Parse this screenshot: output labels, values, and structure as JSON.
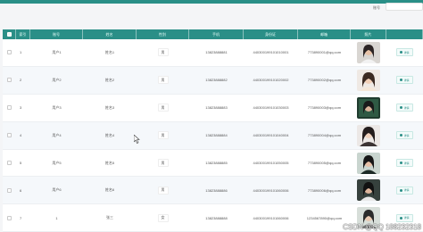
{
  "search": {
    "label": "账号"
  },
  "table": {
    "headers": [
      "",
      "索引",
      "账号",
      "姓名",
      "性别",
      "手机",
      "身份证",
      "邮箱",
      "照片",
      ""
    ],
    "rows": [
      {
        "index": "1",
        "account": "用户1",
        "name": "姓名1",
        "gender": "男",
        "phone": "13823888881",
        "idcard": "440300199101010001",
        "email": "773890001@qq.com",
        "button": "详情"
      },
      {
        "index": "2",
        "account": "用户2",
        "name": "姓名2",
        "gender": "男",
        "phone": "13823888882",
        "idcard": "440300199101020002",
        "email": "773890002@qq.com",
        "button": "详情"
      },
      {
        "index": "3",
        "account": "用户3",
        "name": "姓名3",
        "gender": "男",
        "phone": "13823888883",
        "idcard": "440300199101030003",
        "email": "773890003@qq.com",
        "button": "详情"
      },
      {
        "index": "4",
        "account": "用户4",
        "name": "姓名4",
        "gender": "男",
        "phone": "13823888884",
        "idcard": "440300199101040004",
        "email": "773890004@qq.com",
        "button": "详情"
      },
      {
        "index": "5",
        "account": "用户5",
        "name": "姓名5",
        "gender": "男",
        "phone": "13823888885",
        "idcard": "440300199101050005",
        "email": "773890005@qq.com",
        "button": "详情"
      },
      {
        "index": "6",
        "account": "用户6",
        "name": "姓名6",
        "gender": "男",
        "phone": "13823888886",
        "idcard": "440300199101060006",
        "email": "773890006@qq.com",
        "button": "详情"
      },
      {
        "index": "7",
        "account": "1",
        "name": "张三",
        "gender": "女",
        "phone": "13823888888",
        "idcard": "440300199101060006",
        "email": "1234567890@qq.com",
        "button": "详情"
      }
    ]
  },
  "watermark": "CSDN @QQ 188232318",
  "colors": {
    "header": "#2a8f87",
    "accent": "#2a8f87"
  }
}
